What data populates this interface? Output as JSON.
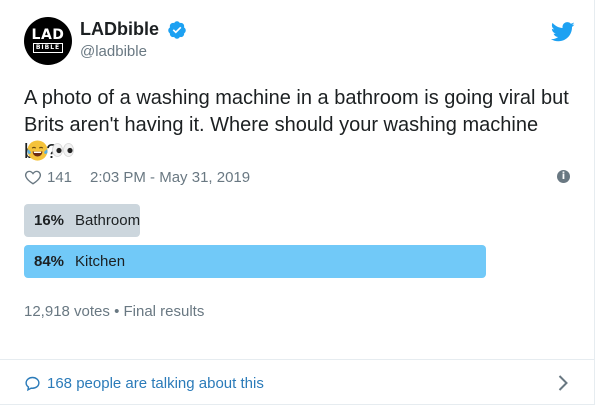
{
  "tweet": {
    "author_name": "LADbible",
    "author_handle": "@ladbible",
    "avatar_text_top": "LAD",
    "avatar_text_bottom": "BIBLE",
    "text": "A photo of a washing machine in a bathroom is going viral but Brits aren't having it. Where should your washing machine be?",
    "likes": "141",
    "timestamp": "2:03 PM - May 31, 2019"
  },
  "poll": {
    "options": [
      {
        "percent_label": "16%",
        "label": "Bathroom",
        "percent": 16,
        "winner": false
      },
      {
        "percent_label": "84%",
        "label": "Kitchen",
        "percent": 84,
        "winner": true
      }
    ],
    "summary": "12,918 votes • Final results"
  },
  "footer": {
    "talking_text": "168 people are talking about this"
  },
  "icons": {
    "verified": "verified-badge-icon",
    "twitter": "twitter-bird-icon",
    "heart": "heart-icon",
    "info": "info-icon",
    "reply": "speech-bubble-icon",
    "chevron": "chevron-right-icon",
    "emoji_1": "face-with-tears-of-joy-icon",
    "emoji_2": "eyes-icon"
  },
  "colors": {
    "accent": "#1da1f2",
    "poll_winner": "#71c9f8",
    "poll_loser": "#ccd6dd",
    "link": "#2b7bb9",
    "muted": "#697882"
  }
}
